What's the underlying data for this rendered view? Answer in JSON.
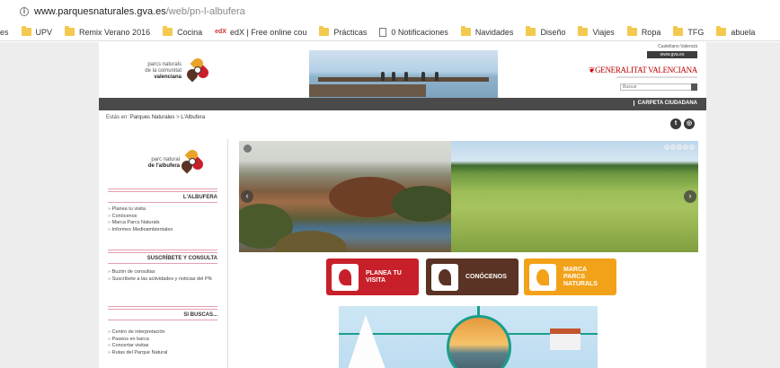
{
  "browser": {
    "url_host": "www.parquesnaturales.gva.es",
    "url_path": "/web/pn-l-albufera",
    "bookmarks": [
      {
        "label": "es",
        "type": "text"
      },
      {
        "label": "UPV",
        "type": "folder"
      },
      {
        "label": "Remix Verano 2016",
        "type": "folder"
      },
      {
        "label": "Cocina",
        "type": "folder"
      },
      {
        "label": "edX | Free online cou",
        "type": "edx"
      },
      {
        "label": "Prácticas",
        "type": "folder"
      },
      {
        "label": "0 Notificaciones",
        "type": "doc"
      },
      {
        "label": "Navidades",
        "type": "folder"
      },
      {
        "label": "Diseño",
        "type": "folder"
      },
      {
        "label": "Viajes",
        "type": "folder"
      },
      {
        "label": "Ropa",
        "type": "folder"
      },
      {
        "label": "TFG",
        "type": "folder"
      },
      {
        "label": "abuela",
        "type": "folder"
      }
    ]
  },
  "header": {
    "logo_line1": "parcs naturals",
    "logo_line2": "de la comunitat",
    "logo_line3": "valenciana",
    "lang": "Castellano  Valencià",
    "gva_tag": "www.gva.es",
    "gen_logo": "GENERALITAT VALENCIANA",
    "search_placeholder": "Buscar",
    "carpeta": "CARPETA CIUDADANA"
  },
  "breadcrumb": {
    "prefix": "Estás en:",
    "item1": "Parques Naturales",
    "sep": ">",
    "item2": "L'Albufera"
  },
  "sidebar": {
    "pn_line1": "parc natural",
    "pn_line2": "de l'albufera",
    "section1": "L'ALBUFERA",
    "section1_links": [
      "Planea tu visita",
      "Conócenos",
      "Marca Parcs Naturals",
      "Informes Medioambientales"
    ],
    "section2": "SUSCRÍBETE Y CONSULTA",
    "section2_links": [
      "Buzón de consultas",
      "Suscríbete a las actividades y noticias del PN"
    ],
    "section3": "SI BUSCAS...",
    "section3_links": [
      "Centro de interpretación",
      "Paseos en barca",
      "Concertar visitas",
      "Rutas del Parque Natural"
    ]
  },
  "slider": {
    "prev": "‹",
    "next": "›"
  },
  "buttons": {
    "planea": "PLANEA TU VISITA",
    "conocenos": "CONÓCENOS",
    "marca": "MARCA PARCS NATURALS"
  },
  "colors": {
    "red": "#c8202a",
    "brown": "#5a3324",
    "orange": "#f2a219",
    "dark": "#4a4a4a",
    "teal": "#1b9e8a"
  }
}
